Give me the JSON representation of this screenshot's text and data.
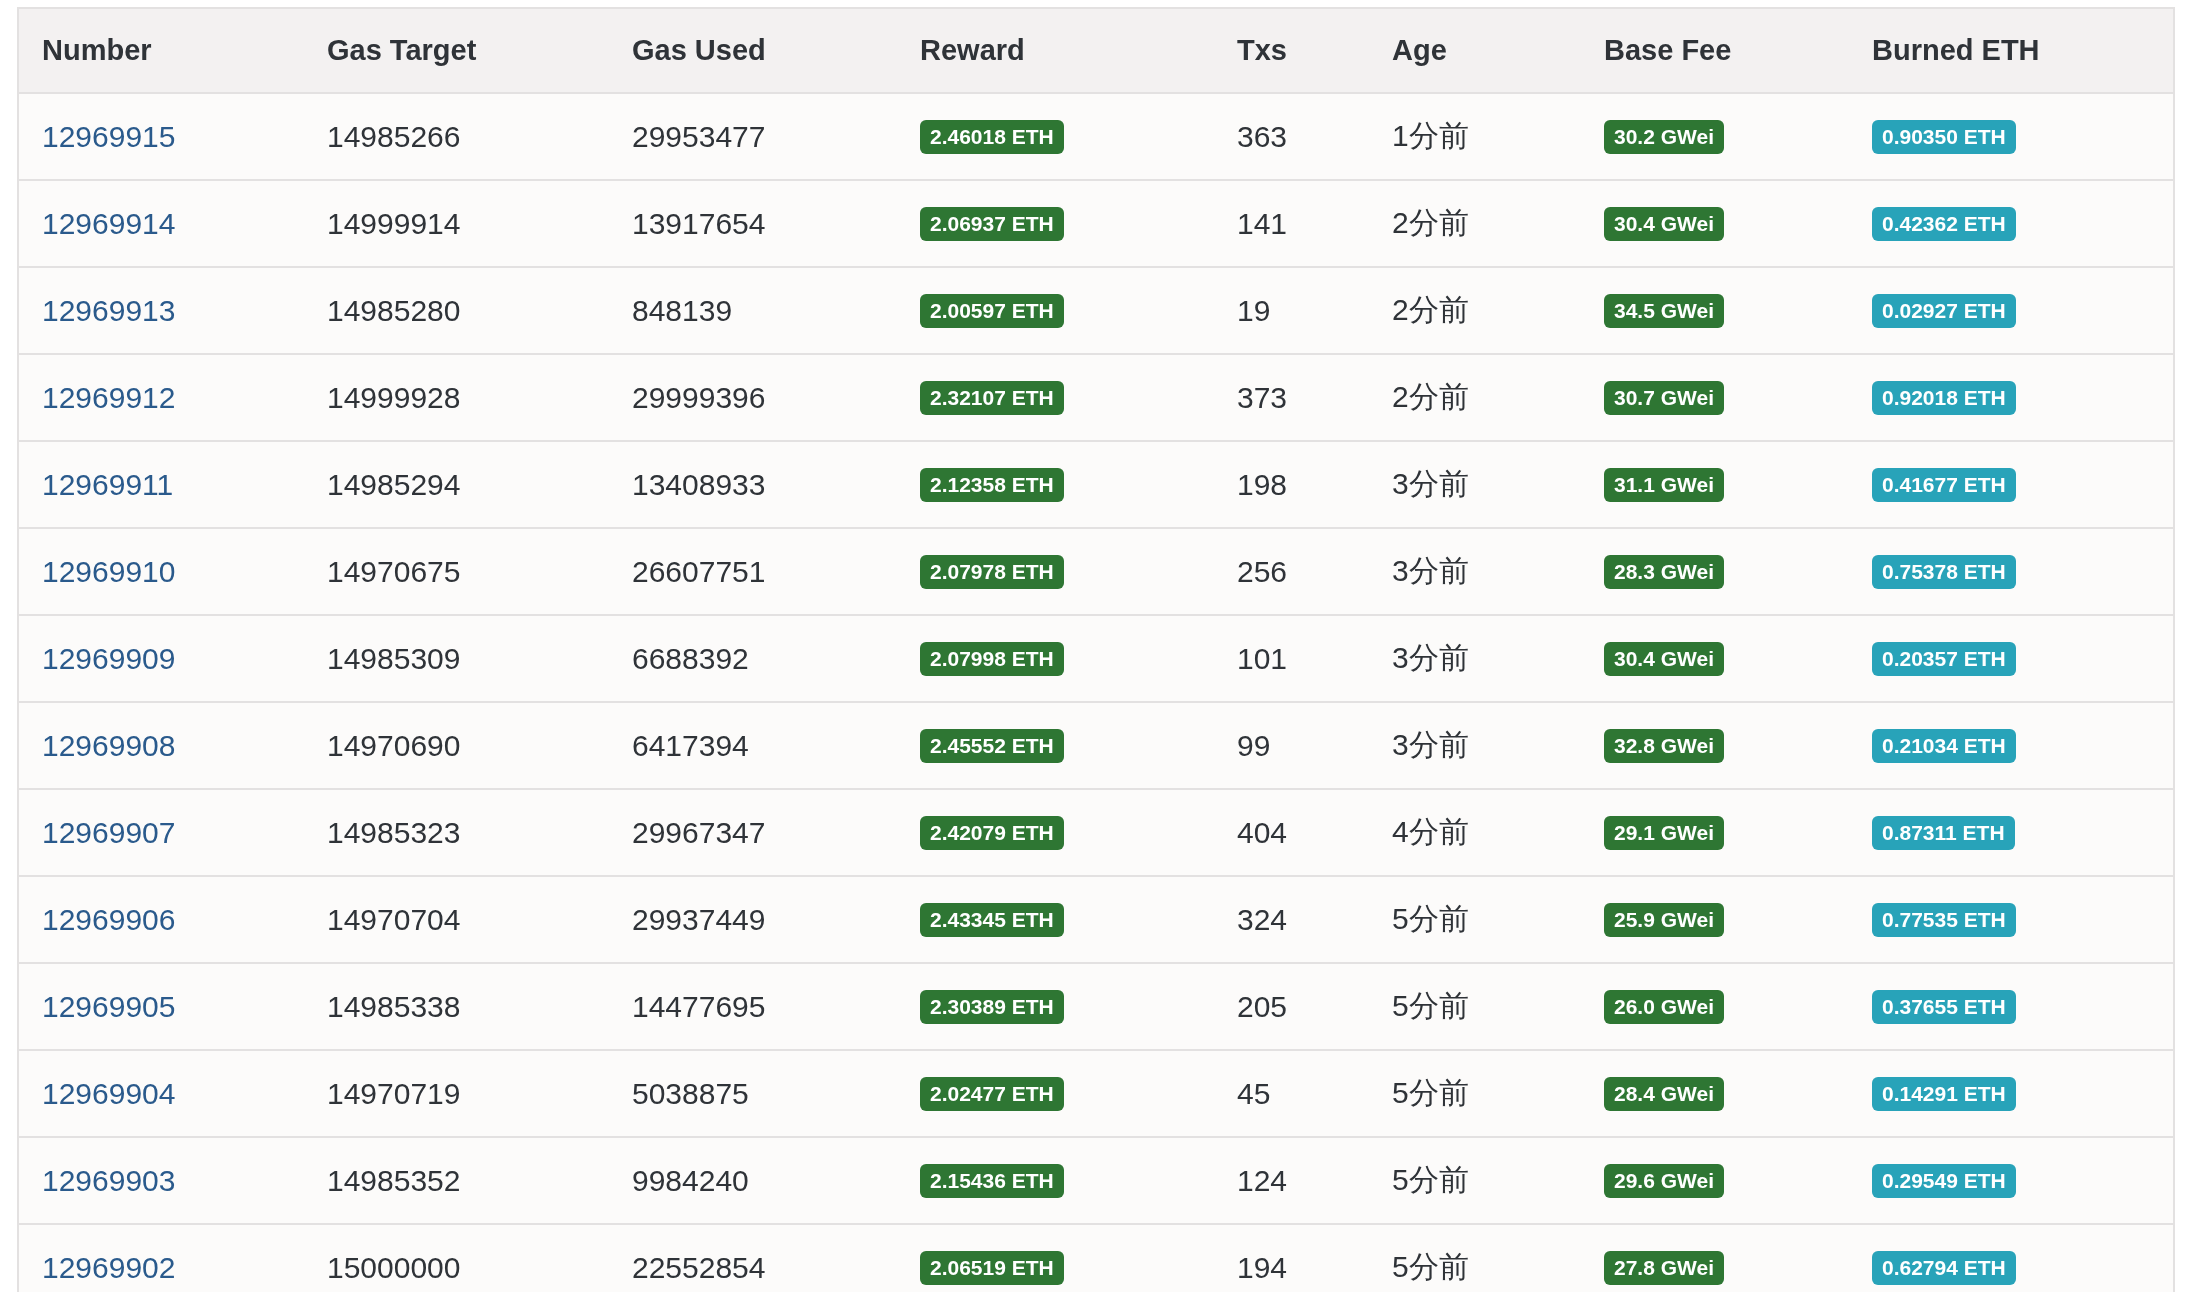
{
  "table": {
    "columns": [
      "Number",
      "Gas Target",
      "Gas Used",
      "Reward",
      "Txs",
      "Age",
      "Base Fee",
      "Burned ETH"
    ],
    "rows": [
      {
        "number": "12969915",
        "gas_target": "14985266",
        "gas_used": "29953477",
        "reward": "2.46018 ETH",
        "txs": "363",
        "age": "1分前",
        "base_fee": "30.2 GWei",
        "burned_eth": "0.90350 ETH"
      },
      {
        "number": "12969914",
        "gas_target": "14999914",
        "gas_used": "13917654",
        "reward": "2.06937 ETH",
        "txs": "141",
        "age": "2分前",
        "base_fee": "30.4 GWei",
        "burned_eth": "0.42362 ETH"
      },
      {
        "number": "12969913",
        "gas_target": "14985280",
        "gas_used": "848139",
        "reward": "2.00597 ETH",
        "txs": "19",
        "age": "2分前",
        "base_fee": "34.5 GWei",
        "burned_eth": "0.02927 ETH"
      },
      {
        "number": "12969912",
        "gas_target": "14999928",
        "gas_used": "29999396",
        "reward": "2.32107 ETH",
        "txs": "373",
        "age": "2分前",
        "base_fee": "30.7 GWei",
        "burned_eth": "0.92018 ETH"
      },
      {
        "number": "12969911",
        "gas_target": "14985294",
        "gas_used": "13408933",
        "reward": "2.12358 ETH",
        "txs": "198",
        "age": "3分前",
        "base_fee": "31.1 GWei",
        "burned_eth": "0.41677 ETH"
      },
      {
        "number": "12969910",
        "gas_target": "14970675",
        "gas_used": "26607751",
        "reward": "2.07978 ETH",
        "txs": "256",
        "age": "3分前",
        "base_fee": "28.3 GWei",
        "burned_eth": "0.75378 ETH"
      },
      {
        "number": "12969909",
        "gas_target": "14985309",
        "gas_used": "6688392",
        "reward": "2.07998 ETH",
        "txs": "101",
        "age": "3分前",
        "base_fee": "30.4 GWei",
        "burned_eth": "0.20357 ETH"
      },
      {
        "number": "12969908",
        "gas_target": "14970690",
        "gas_used": "6417394",
        "reward": "2.45552 ETH",
        "txs": "99",
        "age": "3分前",
        "base_fee": "32.8 GWei",
        "burned_eth": "0.21034 ETH"
      },
      {
        "number": "12969907",
        "gas_target": "14985323",
        "gas_used": "29967347",
        "reward": "2.42079 ETH",
        "txs": "404",
        "age": "4分前",
        "base_fee": "29.1 GWei",
        "burned_eth": "0.87311 ETH"
      },
      {
        "number": "12969906",
        "gas_target": "14970704",
        "gas_used": "29937449",
        "reward": "2.43345 ETH",
        "txs": "324",
        "age": "5分前",
        "base_fee": "25.9 GWei",
        "burned_eth": "0.77535 ETH"
      },
      {
        "number": "12969905",
        "gas_target": "14985338",
        "gas_used": "14477695",
        "reward": "2.30389 ETH",
        "txs": "205",
        "age": "5分前",
        "base_fee": "26.0 GWei",
        "burned_eth": "0.37655 ETH"
      },
      {
        "number": "12969904",
        "gas_target": "14970719",
        "gas_used": "5038875",
        "reward": "2.02477 ETH",
        "txs": "45",
        "age": "5分前",
        "base_fee": "28.4 GWei",
        "burned_eth": "0.14291 ETH"
      },
      {
        "number": "12969903",
        "gas_target": "14985352",
        "gas_used": "9984240",
        "reward": "2.15436 ETH",
        "txs": "124",
        "age": "5分前",
        "base_fee": "29.6 GWei",
        "burned_eth": "0.29549 ETH"
      },
      {
        "number": "12969902",
        "gas_target": "15000000",
        "gas_used": "22552854",
        "reward": "2.06519 ETH",
        "txs": "194",
        "age": "5分前",
        "base_fee": "27.8 GWei",
        "burned_eth": "0.62794 ETH"
      }
    ]
  }
}
